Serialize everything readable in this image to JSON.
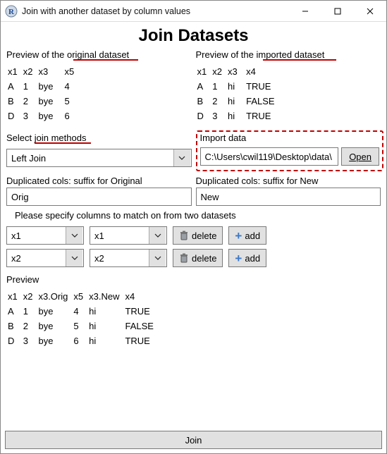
{
  "window": {
    "title": "Join with another dataset by column values"
  },
  "heading": "Join Datasets",
  "preview_original": {
    "label": "Preview of the original dataset",
    "headers": [
      "x1",
      "x2",
      "x3",
      "x5"
    ],
    "rows": [
      [
        "A",
        "1",
        "bye",
        "4"
      ],
      [
        "B",
        "2",
        "bye",
        "5"
      ],
      [
        "D",
        "3",
        "bye",
        "6"
      ]
    ]
  },
  "preview_imported": {
    "label": "Preview of the imported dataset",
    "headers": [
      "x1",
      "x2",
      "x3",
      "x4"
    ],
    "rows": [
      [
        "A",
        "1",
        "hi",
        "TRUE"
      ],
      [
        "B",
        "2",
        "hi",
        "FALSE"
      ],
      [
        "D",
        "3",
        "hi",
        "TRUE"
      ]
    ]
  },
  "join_method": {
    "label": "Select join methods",
    "value": "Left Join"
  },
  "import_data": {
    "label": "Import data",
    "path": "C:\\Users\\cwil119\\Desktop\\data\\",
    "open_label": "Open"
  },
  "dup_original": {
    "label": "Duplicated cols: suffix for Original",
    "value": "Orig"
  },
  "dup_new": {
    "label": "Duplicated cols: suffix for New",
    "value": "New"
  },
  "match_instruction": "Please specify columns to match on from two datasets",
  "match_rows": [
    {
      "left": "x1",
      "right": "x1"
    },
    {
      "left": "x2",
      "right": "x2"
    }
  ],
  "buttons": {
    "delete": "delete",
    "add": "add",
    "join": "Join"
  },
  "preview_result": {
    "label": "Preview",
    "headers": [
      "x1",
      "x2",
      "x3.Orig",
      "x5",
      "x3.New",
      "x4"
    ],
    "rows": [
      [
        "A",
        "1",
        "bye",
        "4",
        "hi",
        "TRUE"
      ],
      [
        "B",
        "2",
        "bye",
        "5",
        "hi",
        "FALSE"
      ],
      [
        "D",
        "3",
        "bye",
        "6",
        "hi",
        "TRUE"
      ]
    ]
  }
}
